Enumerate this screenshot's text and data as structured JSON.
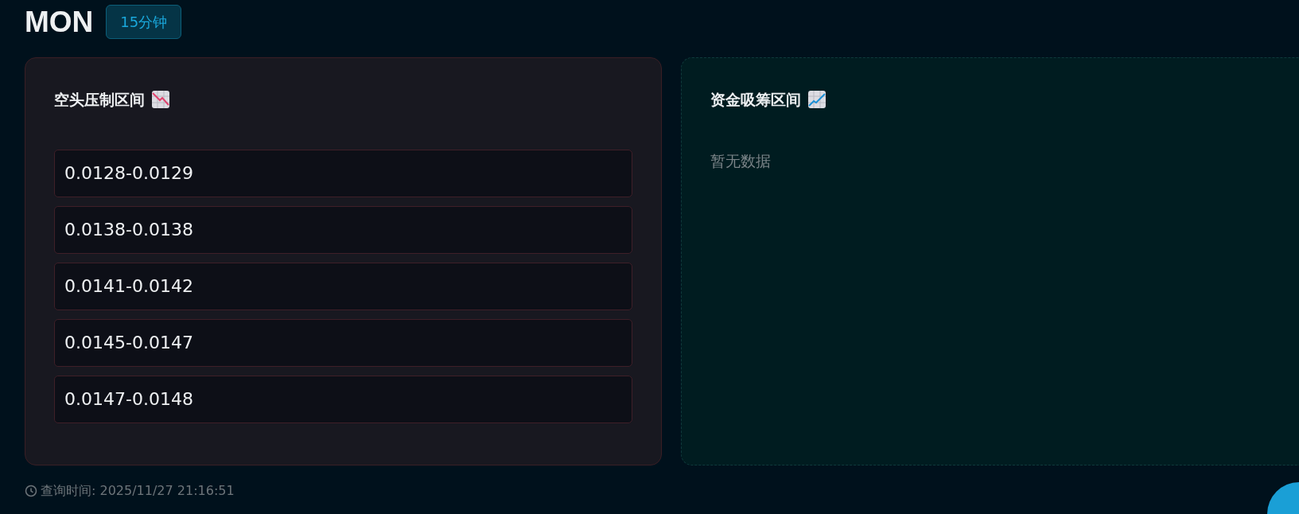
{
  "header": {
    "symbol": "MON",
    "timeframe": "15分钟"
  },
  "panels": [
    {
      "kind": "bearish",
      "title": "空头压制区间",
      "ranges": [
        "0.0128-0.0129",
        "0.0138-0.0138",
        "0.0141-0.0142",
        "0.0145-0.0147",
        "0.0147-0.0148"
      ]
    },
    {
      "kind": "bullish",
      "title": "资金吸筹区间",
      "empty_text": "暂无数据"
    }
  ],
  "footer": {
    "query_time": "查询时间: 2025/11/27 21:16:51"
  }
}
